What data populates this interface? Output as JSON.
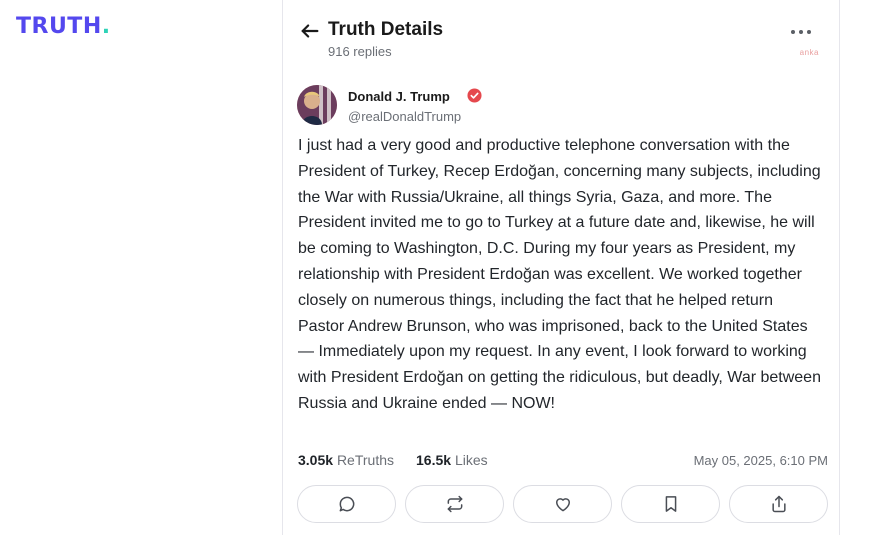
{
  "brand": {
    "logo_text": "TRUTH",
    "logo_dot": ".",
    "color": "#5448ee",
    "dot_color": "#2ed3b7"
  },
  "header": {
    "title": "Truth Details",
    "reply_count": "916 replies",
    "watermark": "anka",
    "icons": {
      "back": "arrow-left-icon",
      "more": "more-horizontal-icon"
    }
  },
  "post": {
    "author_name": "Donald J. Trump",
    "author_handle": "@realDonaldTrump",
    "verified_color": "#e5484d",
    "text": "I just had a very good and productive telephone conversation with the President of Turkey, Recep Erdoğan, concerning many subjects, including the War with Russia/Ukraine, all things Syria, Gaza, and more. The President invited me to go to Turkey at a future date and, likewise, he will be coming to Washington, D.C. During my four years as President, my relationship with President Erdoğan was excellent. We worked together closely on numerous things, including the fact that he helped return Pastor Andrew Brunson, who was imprisoned, back to the United States — Immediately upon my request. In any event, I look forward to working with President Erdoğan on getting the ridiculous, but deadly, War between Russia and Ukraine ended — NOW!",
    "retruths_count": "3.05k",
    "retruths_label": "ReTruths",
    "likes_count": "16.5k",
    "likes_label": "Likes",
    "timestamp": "May 05, 2025, 6:10 PM"
  },
  "actions": [
    {
      "name": "reply",
      "icon": "comment-icon"
    },
    {
      "name": "retruth",
      "icon": "repost-icon"
    },
    {
      "name": "like",
      "icon": "heart-icon"
    },
    {
      "name": "bookmark",
      "icon": "bookmark-icon"
    },
    {
      "name": "share",
      "icon": "share-icon"
    }
  ]
}
